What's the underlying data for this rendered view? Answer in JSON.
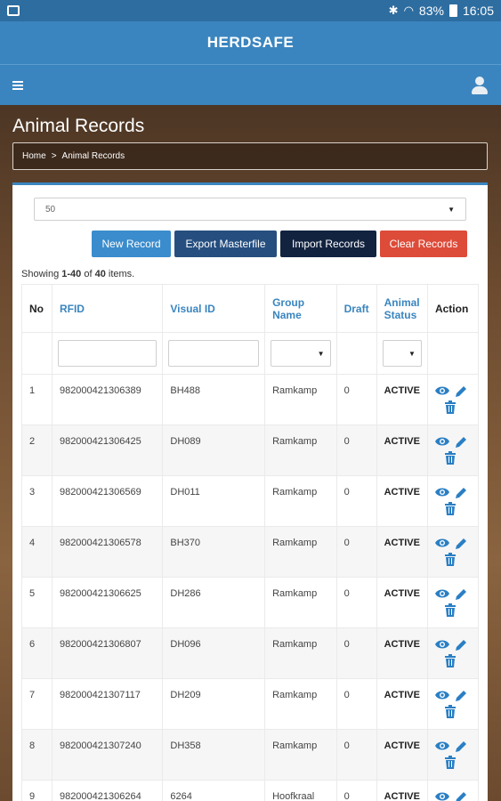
{
  "status_bar": {
    "battery": "83%",
    "time": "16:05"
  },
  "app": {
    "title": "HERDSAFE"
  },
  "page": {
    "title": "Animal Records",
    "breadcrumb": {
      "home": "Home",
      "separator": ">",
      "current": "Animal Records"
    }
  },
  "controls": {
    "page_size": "50",
    "buttons": {
      "new_record": "New Record",
      "export_masterfile": "Export Masterfile",
      "import_records": "Import Records",
      "clear_records": "Clear Records"
    },
    "summary": {
      "prefix": "Showing ",
      "range": "1-40",
      "middle": " of ",
      "total": "40",
      "suffix": " items."
    }
  },
  "table": {
    "headers": {
      "no": "No",
      "rfid": "RFID",
      "visual_id": "Visual ID",
      "group_name_1": "Group",
      "group_name_2": "Name",
      "draft": "Draft",
      "animal_status_1": "Animal",
      "animal_status_2": "Status",
      "action": "Action"
    },
    "rows": [
      {
        "no": "1",
        "rfid": "982000421306389",
        "visual_id": "BH488",
        "group": "Ramkamp",
        "draft": "0",
        "status": "ACTIVE"
      },
      {
        "no": "2",
        "rfid": "982000421306425",
        "visual_id": "DH089",
        "group": "Ramkamp",
        "draft": "0",
        "status": "ACTIVE"
      },
      {
        "no": "3",
        "rfid": "982000421306569",
        "visual_id": "DH011",
        "group": "Ramkamp",
        "draft": "0",
        "status": "ACTIVE"
      },
      {
        "no": "4",
        "rfid": "982000421306578",
        "visual_id": "BH370",
        "group": "Ramkamp",
        "draft": "0",
        "status": "ACTIVE"
      },
      {
        "no": "5",
        "rfid": "982000421306625",
        "visual_id": "DH286",
        "group": "Ramkamp",
        "draft": "0",
        "status": "ACTIVE"
      },
      {
        "no": "6",
        "rfid": "982000421306807",
        "visual_id": "DH096",
        "group": "Ramkamp",
        "draft": "0",
        "status": "ACTIVE"
      },
      {
        "no": "7",
        "rfid": "982000421307117",
        "visual_id": "DH209",
        "group": "Ramkamp",
        "draft": "0",
        "status": "ACTIVE"
      },
      {
        "no": "8",
        "rfid": "982000421307240",
        "visual_id": "DH358",
        "group": "Ramkamp",
        "draft": "0",
        "status": "ACTIVE"
      },
      {
        "no": "9",
        "rfid": "982000421306264",
        "visual_id": "6264",
        "group": "Hoofkraal",
        "draft": "0",
        "status": "ACTIVE"
      }
    ]
  },
  "icons": {
    "menu": "menu-icon",
    "user": "user-icon",
    "view": "eye-icon",
    "edit": "pencil-icon",
    "delete": "trash-icon"
  },
  "colors": {
    "primary": "#3a85bf",
    "danger": "#dd4b39",
    "dark_navy": "#122340",
    "navy": "#264f80"
  }
}
